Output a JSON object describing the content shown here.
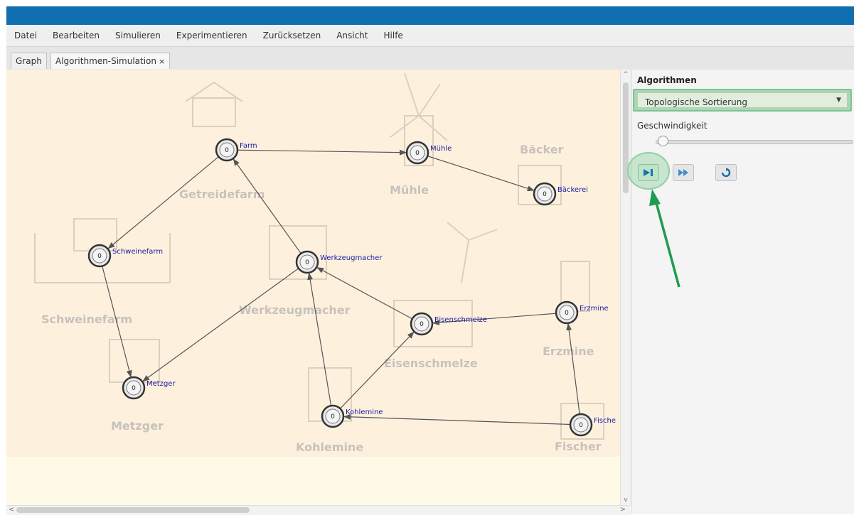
{
  "window": {
    "accent": "#0e6eb0"
  },
  "menu": [
    "Datei",
    "Bearbeiten",
    "Simulieren",
    "Experimentieren",
    "Zurücksetzen",
    "Ansicht",
    "Hilfe"
  ],
  "tabs": {
    "graph": "Graph",
    "simulation": "Algorithmen-Simulation",
    "close": "×"
  },
  "panel": {
    "title": "Algorithmen",
    "algorithm_selected": "Topologische Sortierung",
    "speed_label": "Geschwindigkeit",
    "speed_value": 0.02,
    "buttons": [
      "step-icon",
      "fast-forward-icon",
      "reset-icon"
    ]
  },
  "graph": {
    "nodes": [
      {
        "id": "farm",
        "label": "Farm",
        "value": "0"
      },
      {
        "id": "muehle",
        "label": "Mühle",
        "value": "0"
      },
      {
        "id": "baeckerei",
        "label": "Bäckerei",
        "value": "0"
      },
      {
        "id": "schweinefarm",
        "label": "Schweinefarm",
        "value": "0"
      },
      {
        "id": "werkzeugmacher",
        "label": "Werkzeugmacher",
        "value": "0"
      },
      {
        "id": "eisenschmelze",
        "label": "Eisenschmelze",
        "value": "0"
      },
      {
        "id": "erzmine",
        "label": "Erzmine",
        "value": "0"
      },
      {
        "id": "metzger",
        "label": "Metzger",
        "value": "0"
      },
      {
        "id": "kohlemine",
        "label": "Kohlemine",
        "value": "0"
      },
      {
        "id": "fischer",
        "label": "Fische",
        "value": "0"
      }
    ],
    "background_labels": [
      "Getreidefarm",
      "Mühle",
      "Bäcker",
      "Schweinefarm",
      "Werkzeugmacher",
      "Eisenschmelze",
      "Erzmine",
      "Metzger",
      "Kohlemine",
      "Fischer"
    ]
  }
}
